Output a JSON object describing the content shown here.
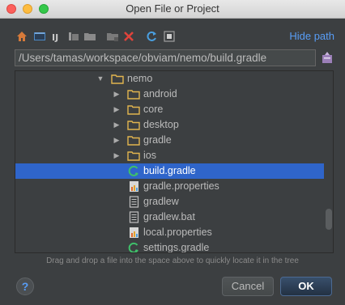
{
  "window": {
    "title": "Open File or Project"
  },
  "toolbar": {
    "icons": [
      "home-icon",
      "desktop-icon",
      "project-icon",
      "new-folder-icon",
      "new-folder-alt-icon",
      "delete-icon",
      "refresh-icon",
      "show-hidden-icon"
    ],
    "hide_path_label": "Hide path"
  },
  "path": {
    "value": "/Users/tamas/workspace/obviam/nemo/build.gradle"
  },
  "tree": {
    "items": [
      {
        "label": "nemo",
        "type": "folder",
        "expanded": true,
        "selected": false
      },
      {
        "label": "android",
        "type": "folder",
        "expanded": false,
        "selected": false
      },
      {
        "label": "core",
        "type": "folder",
        "expanded": false,
        "selected": false
      },
      {
        "label": "desktop",
        "type": "folder",
        "expanded": false,
        "selected": false
      },
      {
        "label": "gradle",
        "type": "folder",
        "expanded": false,
        "selected": false
      },
      {
        "label": "ios",
        "type": "folder",
        "expanded": false,
        "selected": false
      },
      {
        "label": "build.gradle",
        "type": "gradle-file",
        "selected": true
      },
      {
        "label": "gradle.properties",
        "type": "properties-file",
        "selected": false
      },
      {
        "label": "gradlew",
        "type": "text-file",
        "selected": false
      },
      {
        "label": "gradlew.bat",
        "type": "text-file",
        "selected": false
      },
      {
        "label": "local.properties",
        "type": "properties-file",
        "selected": false
      },
      {
        "label": "settings.gradle",
        "type": "gradle-file",
        "selected": false
      }
    ]
  },
  "hint": "Drag and drop a file into the space above to quickly locate it in the tree",
  "buttons": {
    "help": "?",
    "cancel": "Cancel",
    "ok": "OK"
  },
  "colors": {
    "accent": "#589df6",
    "selection": "#2f65ca",
    "background": "#3c3f41",
    "folder": "#e2b54f"
  }
}
